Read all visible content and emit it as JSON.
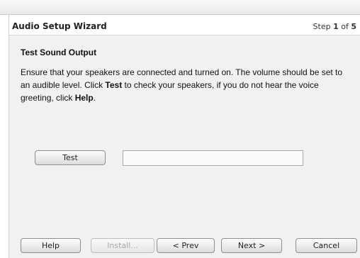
{
  "window": {
    "title": "Audio Setup Wizard",
    "step": {
      "prefix": "Step",
      "current": "1",
      "separator": "of",
      "total": "5"
    }
  },
  "content": {
    "section_title": "Test Sound Output",
    "instructions": {
      "part1": "Ensure that your speakers are connected and turned on. The volume should be set to an audible level. Click ",
      "bold1": "Test",
      "part2": " to check your speakers, if you do not hear the voice greeting, click ",
      "bold2": "Help",
      "part3": "."
    },
    "test_button": "Test",
    "result_field_value": ""
  },
  "footer": {
    "help": "Help",
    "install": "Install...",
    "prev": "< Prev",
    "next": "Next >",
    "cancel": "Cancel"
  }
}
